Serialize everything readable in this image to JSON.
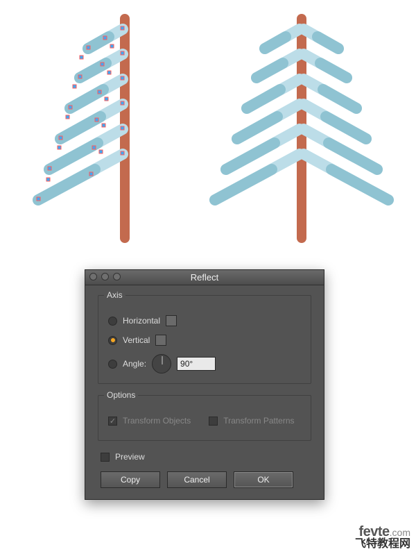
{
  "illustration": {
    "trunk_color": "#c36a4e",
    "branch_light": "#bcdde8",
    "branch_dark": "#8fc3d2",
    "anchor_fill": "#3fa9f5",
    "anchor_stroke": "#ff5a5a"
  },
  "dialog": {
    "title": "Reflect",
    "axis": {
      "group_label": "Axis",
      "horizontal_label": "Horizontal",
      "vertical_label": "Vertical",
      "angle_label": "Angle:",
      "angle_value": "90°",
      "selected": "vertical"
    },
    "options": {
      "group_label": "Options",
      "transform_objects_label": "Transform Objects",
      "transform_objects_checked": true,
      "transform_patterns_label": "Transform Patterns",
      "transform_patterns_checked": false
    },
    "preview": {
      "label": "Preview",
      "checked": false
    },
    "buttons": {
      "copy": "Copy",
      "cancel": "Cancel",
      "ok": "OK"
    }
  },
  "watermark": {
    "line1a": "fevte",
    "line1b": ".com",
    "line2": "飞特教程网"
  }
}
